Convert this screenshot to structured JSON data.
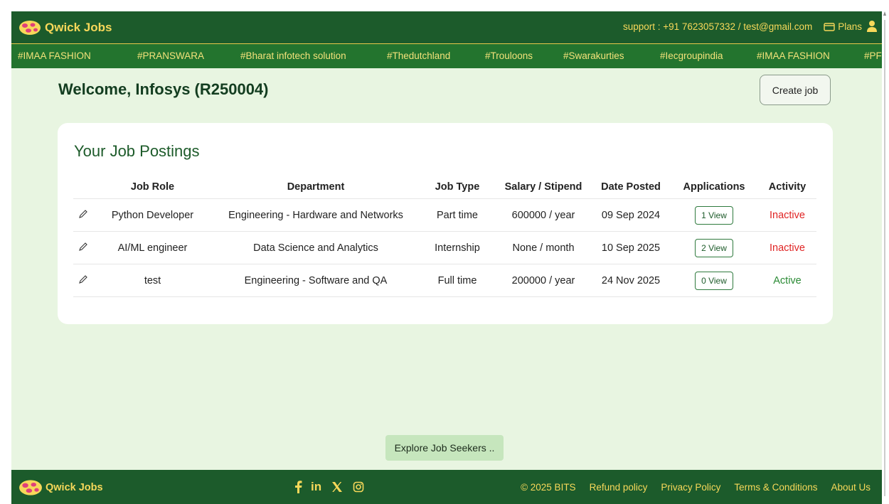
{
  "header": {
    "brand": "Qwick Jobs",
    "support": "support : +91 7623057332 / test@gmail.com",
    "plans": "Plans",
    "icons": {
      "plans": "card-icon",
      "user": "user-icon",
      "logo": "qwick-logo"
    }
  },
  "tags": [
    "#IMAA FASHION",
    "#PRANSWARA",
    "#Bharat infotech solution",
    "#Thedutchland",
    "#Trouloons",
    "#Swarakurties",
    "#Iecgroupindia",
    "#IMAA FASHION",
    "#PF"
  ],
  "welcome": "Welcome, Infosys (R250004)",
  "create_job": "Create job",
  "postings": {
    "title": "Your Job Postings",
    "columns": [
      "Job Role",
      "Department",
      "Job Type",
      "Salary / Stipend",
      "Date Posted",
      "Applications",
      "Activity"
    ],
    "rows": [
      {
        "role": "Python Developer",
        "department": "Engineering - Hardware and Networks",
        "type": "Part time",
        "salary": "600000 / year",
        "date": "09 Sep 2024",
        "applications": "1 View",
        "activity": "Inactive"
      },
      {
        "role": "AI/ML engineer",
        "department": "Data Science and Analytics",
        "type": "Internship",
        "salary": "None / month",
        "date": "10 Sep 2025",
        "applications": "2 View",
        "activity": "Inactive"
      },
      {
        "role": "test",
        "department": "Engineering - Software and QA",
        "type": "Full time",
        "salary": "200000 / year",
        "date": "24 Nov 2025",
        "applications": "0 View",
        "activity": "Active"
      }
    ]
  },
  "explore": "Explore Job Seekers ..",
  "footer": {
    "brand": "Qwick Jobs",
    "socials": [
      "facebook-icon",
      "linkedin-icon",
      "x-icon",
      "instagram-icon"
    ],
    "social_glyphs": {
      "linkedin": "in"
    },
    "copyright": "© 2025 BITS",
    "links": [
      "Refund policy",
      "Privacy Policy",
      "Terms & Conditions",
      "About Us"
    ]
  },
  "colors": {
    "header": "#1c5b2b",
    "tagbar": "#23742e",
    "accent": "#f7d85a",
    "page_bg": "#e8f5e1",
    "inactive": "#e02424",
    "active": "#2a8a34"
  }
}
